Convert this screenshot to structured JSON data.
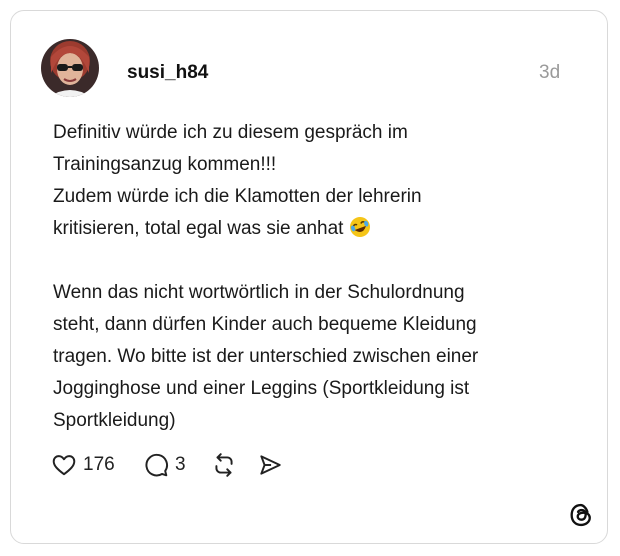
{
  "post": {
    "username": "susi_h84",
    "timestamp": "3d",
    "lines": {
      "l1": "Definitiv würde ich zu diesem gespräch im",
      "l2": "Trainingsanzug kommen!!!",
      "l3": "Zudem würde ich die  Klamotten der lehrerin",
      "l4": "kritisieren, total egal was sie anhat",
      "l5": "Wenn das nicht wortwörtlich in der Schulordnung",
      "l6": "steht, dann dürfen Kinder auch bequeme Kleidung",
      "l7": "tragen. Wo bitte ist der unterschied zwischen einer",
      "l8": "Jogginghose und einer Leggins (Sportkleidung ist",
      "l9": "Sportkleidung)"
    },
    "emoji": "rolling-on-the-floor-laughing"
  },
  "actions": {
    "likes": "176",
    "replies": "3"
  },
  "icons": [
    "heart-icon",
    "comment-icon",
    "repost-icon",
    "share-icon",
    "threads-logo-icon"
  ]
}
